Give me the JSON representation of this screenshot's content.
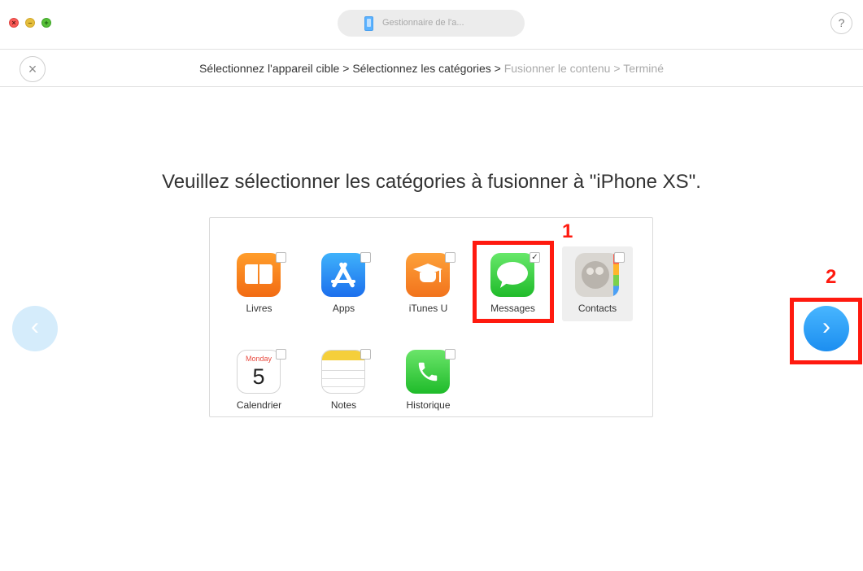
{
  "window": {
    "device_name": "Gestionnaire de l'a...",
    "help_label": "?"
  },
  "breadcrumb": {
    "close_label": "×",
    "steps": [
      "Sélectionnez l'appareil cible",
      "Sélectionnez les catégories",
      "Fusionner le contenu",
      "Terminé"
    ],
    "separator": " > "
  },
  "main": {
    "heading": "Veuillez sélectionner les catégories à fusionner à \"iPhone XS\"."
  },
  "categories": [
    {
      "label": "Livres",
      "checked": false,
      "icon": "books-icon"
    },
    {
      "label": "Apps",
      "checked": false,
      "icon": "app-store-icon"
    },
    {
      "label": "iTunes U",
      "checked": false,
      "icon": "itunes-u-icon"
    },
    {
      "label": "Messages",
      "checked": true,
      "icon": "messages-icon"
    },
    {
      "label": "Contacts",
      "checked": false,
      "icon": "contacts-icon"
    },
    {
      "label": "Calendrier",
      "checked": false,
      "icon": "calendar-icon",
      "calendar_day": "Monday",
      "calendar_date": "5"
    },
    {
      "label": "Notes",
      "checked": false,
      "icon": "notes-icon"
    },
    {
      "label": "Historique",
      "checked": false,
      "icon": "phone-icon"
    }
  ],
  "navigation": {
    "prev_glyph": "‹",
    "next_glyph": "›"
  },
  "annotations": {
    "step1": "1",
    "step2": "2",
    "color": "#ff1a0f"
  },
  "colors": {
    "accent": "#1c8ef0",
    "annotation": "#ff1a0f"
  }
}
